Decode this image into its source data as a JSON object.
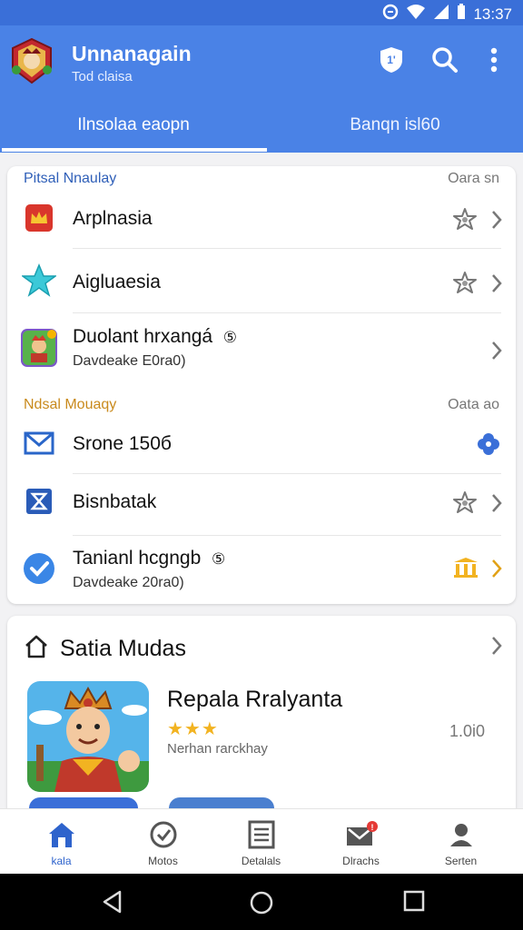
{
  "status_bar": {
    "time": "13:37"
  },
  "app": {
    "title": "Unnanagain",
    "subtitle": "Tod claisa",
    "tabs": [
      {
        "label": "Ilnsolaa eaopn",
        "active": true
      },
      {
        "label": "Banqn isl60",
        "active": false
      }
    ]
  },
  "section1": {
    "header": "Pitsal Nnaulay",
    "header_right": "Oara sn",
    "rows": [
      {
        "label": "Arplnasia",
        "icon": "crown-badge-icon",
        "action": "star-outline-icon"
      },
      {
        "label": "Aigluaesia",
        "icon": "star-teal-icon",
        "action": "star-outline-icon"
      },
      {
        "label": "Duolant hrxangá",
        "badge": "⑤",
        "sub": "Davdeake E0ra0)",
        "icon": "game-thumb-icon",
        "action": "chevron-icon"
      }
    ]
  },
  "section2": {
    "header": "Ndsal Mouaqy",
    "header_right": "Oata ao",
    "rows": [
      {
        "label": "Srone 150б",
        "icon": "mail-icon",
        "action": "flower-badge-icon"
      },
      {
        "label": "Bisnbatak",
        "icon": "hourglass-icon",
        "action": "star-outline-icon"
      },
      {
        "label": "Tanianl hcgngb",
        "badge": "⑤",
        "sub": "Davdeake 20ra0)",
        "icon": "check-circle-icon",
        "action": "columns-gold-icon"
      }
    ]
  },
  "featured": {
    "title": "Satia Mudas",
    "game_name": "Repala Rralyanta",
    "stars": "★★★",
    "description": "Nerhan rarckhay",
    "value": "1.0i0"
  },
  "bottom_nav": [
    {
      "label": "kala",
      "icon": "home-icon",
      "active": true
    },
    {
      "label": "Motos",
      "icon": "shield-check-icon",
      "active": false
    },
    {
      "label": "Detalals",
      "icon": "list-icon",
      "active": false
    },
    {
      "label": "Dlrachs",
      "icon": "mail-notification-icon",
      "active": false
    },
    {
      "label": "Serten",
      "icon": "person-icon",
      "active": false
    }
  ],
  "colors": {
    "primary": "#4a82e6",
    "status_bar": "#3a6fd8",
    "section_header": "#c98a1d",
    "accent_gold": "#f2b321",
    "nav_active": "#2e63cc"
  }
}
